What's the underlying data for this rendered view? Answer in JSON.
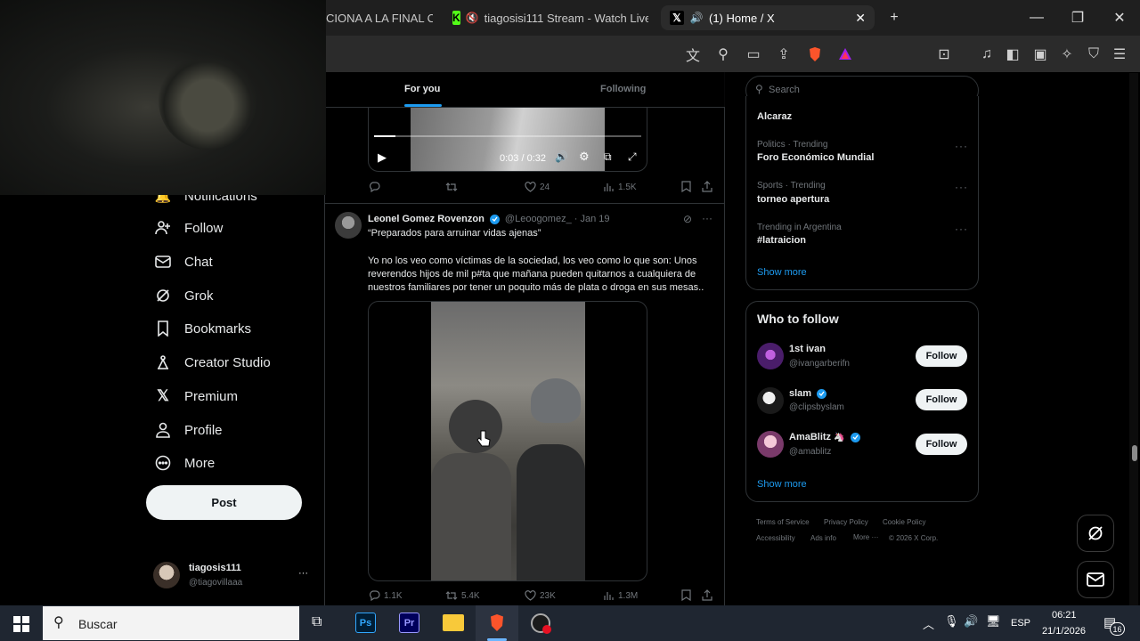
{
  "browser": {
    "tabs": [
      {
        "label": "CIONA A LA FINAL CA",
        "active": false
      },
      {
        "label": "tiagosisi111 Stream - Watch Live",
        "active": false
      },
      {
        "label": "(1) Home / X",
        "active": true
      }
    ],
    "new_tab": "+",
    "window_controls": [
      "minimize",
      "restore",
      "close"
    ]
  },
  "feed_tabs": {
    "for_you": "For you",
    "following": "Following"
  },
  "video1": {
    "time": "0:03 / 0:32",
    "progress": 0.08
  },
  "tweet1_actions": {
    "replies": "",
    "reposts": "",
    "likes": "24",
    "views": "1.5K"
  },
  "tweet2": {
    "author": "Leonel Gomez Rovenzon",
    "handle": "@Leoogomez_",
    "date": "· Jan 19",
    "quote": "“Preparados para arruinar vidas ajenas”",
    "body": "Yo no los veo como víctimas de la sociedad, los veo como lo que son: Unos reverendos hijos de mil p#ta que mañana pueden quitarnos a cualquiera de nuestros familiares por tener un poquito más de plata o droga en sus mesas..",
    "replies": "1.1K",
    "reposts": "5.4K",
    "likes": "23K",
    "views": "1.3M"
  },
  "nav": {
    "notifications": "Notifications",
    "follow": "Follow",
    "chat": "Chat",
    "grok": "Grok",
    "bookmarks": "Bookmarks",
    "creator_studio": "Creator Studio",
    "premium": "Premium",
    "profile": "Profile",
    "more": "More",
    "post": "Post"
  },
  "account": {
    "name": "tiagosis111",
    "handle": "@tiagovillaaa",
    "menu": "···"
  },
  "search": {
    "placeholder": "Search"
  },
  "trends": {
    "top_name": "Alcaraz",
    "items": [
      {
        "category": "Politics · Trending",
        "name": "Foro Económico Mundial"
      },
      {
        "category": "Sports · Trending",
        "name": "torneo apertura"
      },
      {
        "category": "Trending in Argentina",
        "name": "#latraicion"
      }
    ],
    "show_more": "Show more"
  },
  "who_to_follow": {
    "title": "Who to follow",
    "users": [
      {
        "name": "1st ivan",
        "handle": "@ivangarberifn",
        "button": "Follow"
      },
      {
        "name": "slam",
        "handle": "@clipsbyslam",
        "button": "Follow"
      },
      {
        "name": "AmaBlitz",
        "handle": "@amablitz",
        "button": "Follow"
      }
    ],
    "show_more": "Show more"
  },
  "footer": {
    "terms": "Terms of Service",
    "privacy": "Privacy Policy",
    "cookie": "Cookie Policy",
    "accessibility": "Accessibility",
    "ads": "Ads info",
    "more": "More ···",
    "copyright": "© 2026 X Corp."
  },
  "taskbar": {
    "search_placeholder": "Buscar",
    "lang": "ESP",
    "time": "06:21",
    "date": "21/1/2026",
    "notifications": "16"
  },
  "colors": {
    "accent": "#1d9bf0",
    "background": "#000000",
    "text": "#e7e9ea",
    "muted": "#71767b",
    "border": "#2f3336"
  }
}
